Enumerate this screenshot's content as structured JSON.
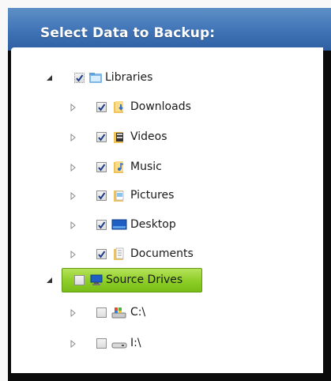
{
  "header": {
    "title": "Select Data to Backup:"
  },
  "tree": {
    "libraries": {
      "label": "Libraries",
      "children": [
        {
          "label": "Downloads"
        },
        {
          "label": "Videos"
        },
        {
          "label": "Music"
        },
        {
          "label": "Pictures"
        },
        {
          "label": "Desktop"
        },
        {
          "label": "Documents"
        }
      ]
    },
    "source_drives": {
      "label": "Source Drives",
      "children": [
        {
          "label": "C:\\"
        },
        {
          "label": "I:\\"
        }
      ]
    }
  },
  "colors": {
    "header_blue": "#3f73b6",
    "selected_green": "#8fcf2a",
    "frame_black": "#0b0b0b"
  }
}
